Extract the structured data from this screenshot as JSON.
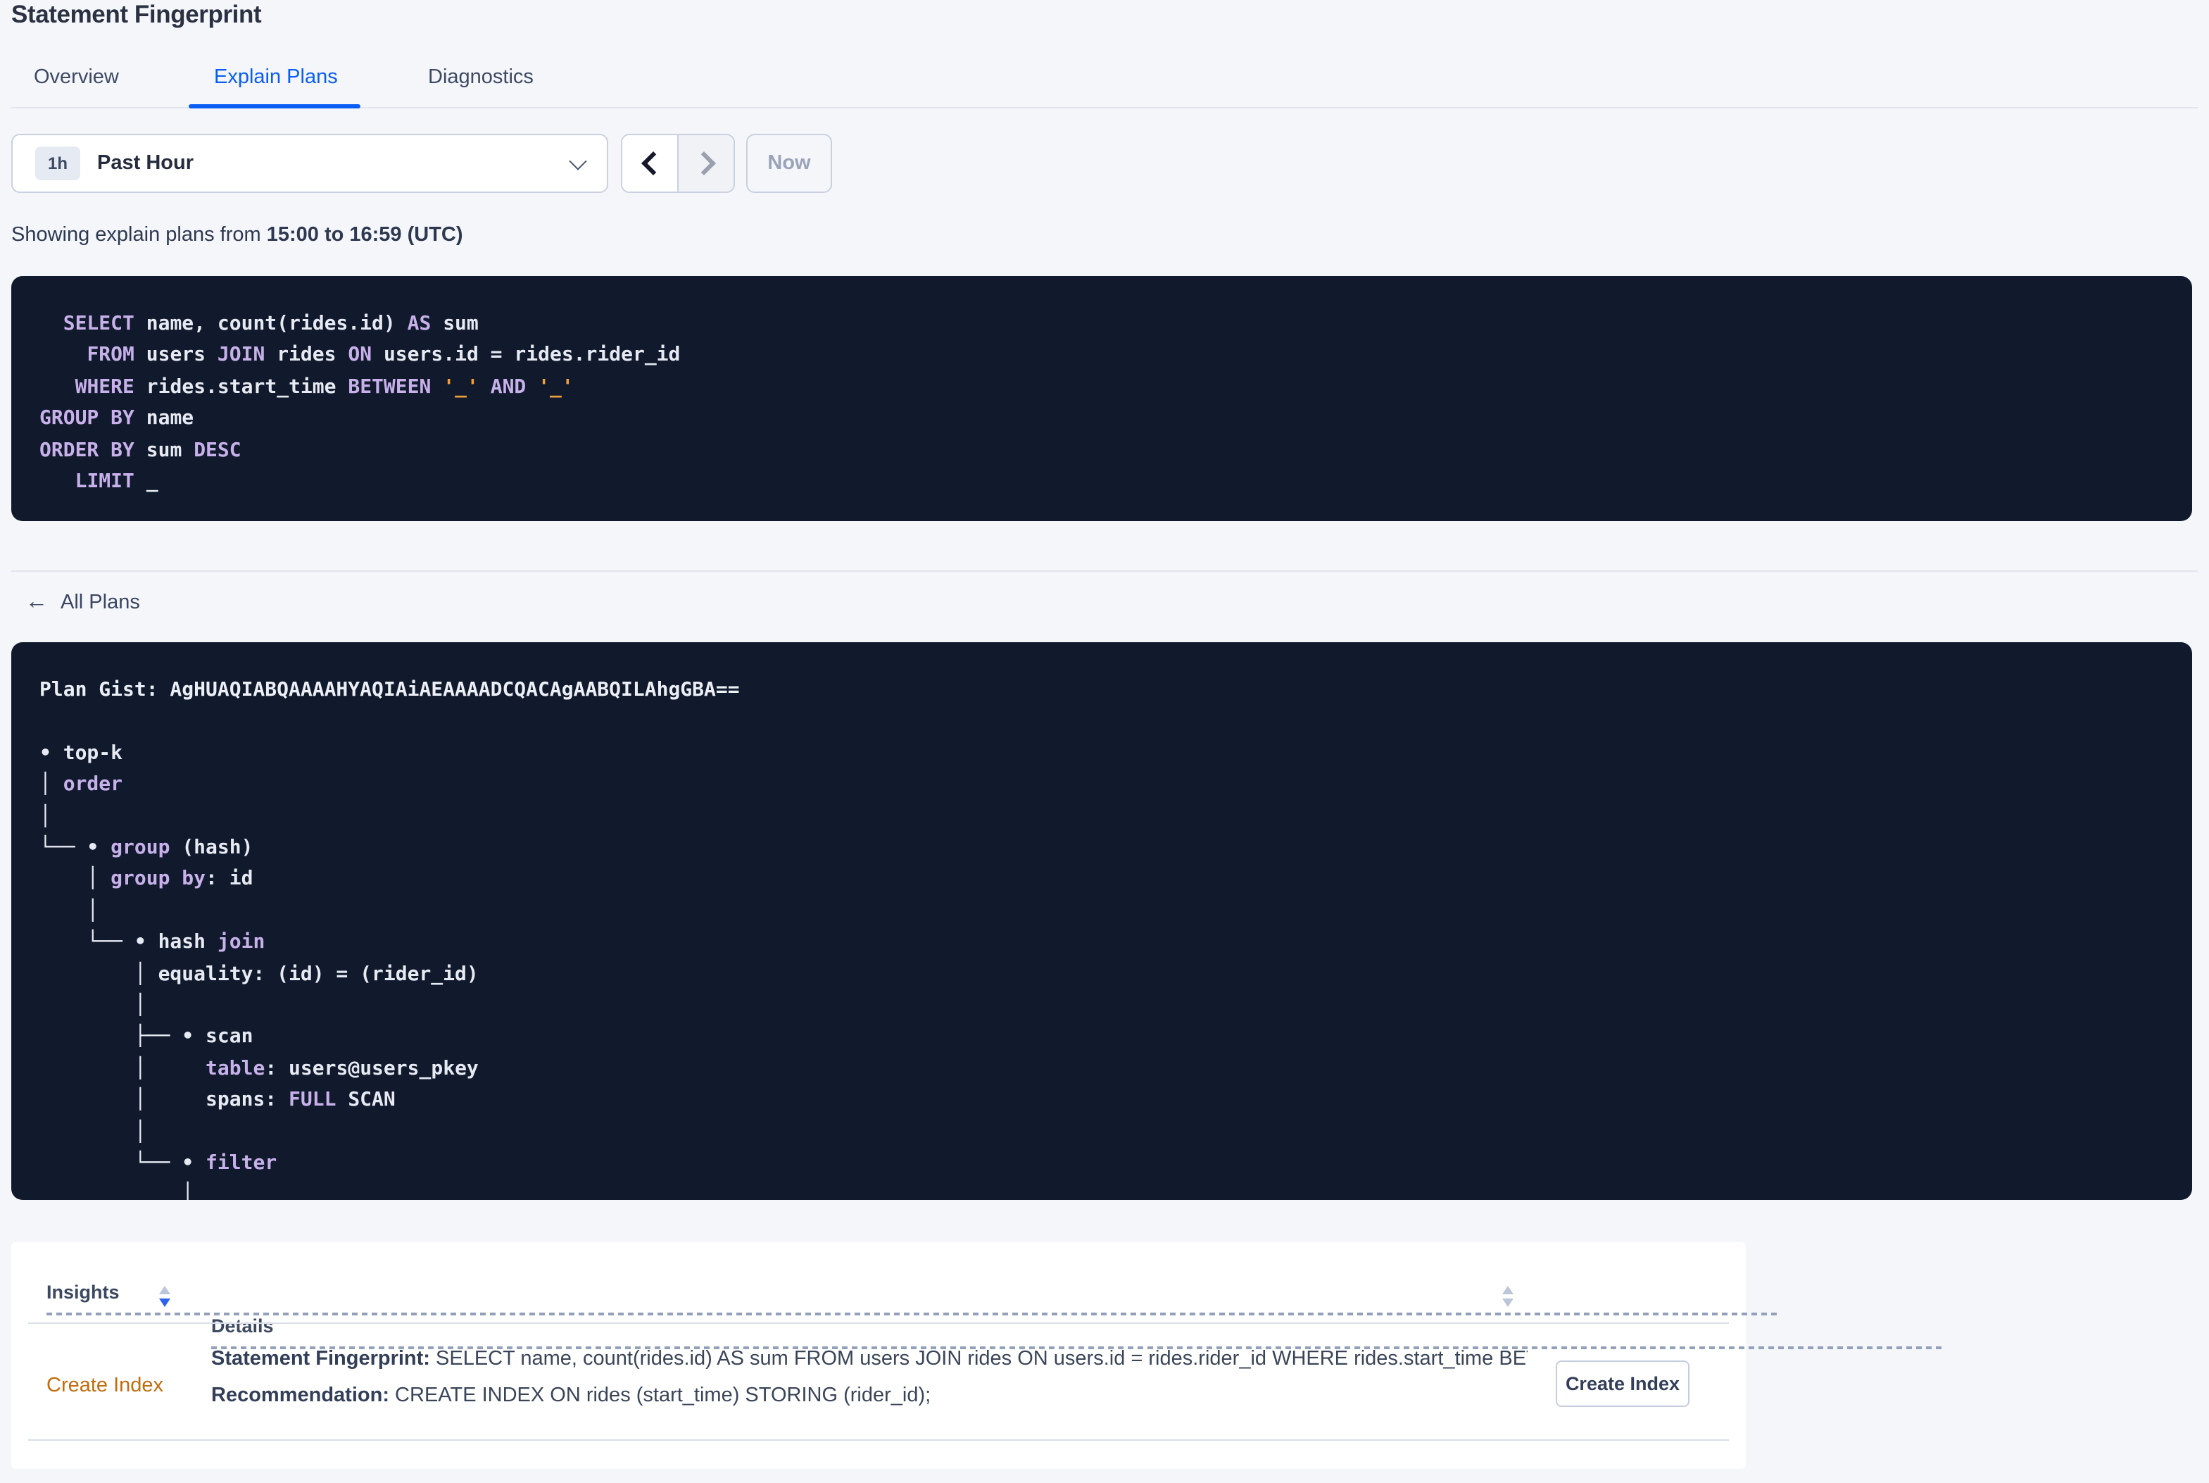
{
  "header": {
    "title": "Statement Fingerprint"
  },
  "tabs": [
    {
      "label": "Overview"
    },
    {
      "label": "Explain Plans"
    },
    {
      "label": "Diagnostics"
    }
  ],
  "toolbar": {
    "range_badge": "1h",
    "range_label": "Past Hour",
    "now_label": "Now"
  },
  "subtitle": {
    "prefix": "Showing explain plans from ",
    "bold_range": "15:00 to 16:59 (UTC)"
  },
  "sql_block": {
    "lines": [
      [
        [
          "p",
          "  "
        ],
        [
          "k",
          "SELECT"
        ],
        [
          "p",
          " name, count(rides.id) "
        ],
        [
          "k",
          "AS"
        ],
        [
          "p",
          " sum"
        ]
      ],
      [
        [
          "p",
          "    "
        ],
        [
          "k",
          "FROM"
        ],
        [
          "p",
          " users "
        ],
        [
          "k",
          "JOIN"
        ],
        [
          "p",
          " rides "
        ],
        [
          "k",
          "ON"
        ],
        [
          "p",
          " users.id = rides.rider_id"
        ]
      ],
      [
        [
          "p",
          "   "
        ],
        [
          "k",
          "WHERE"
        ],
        [
          "p",
          " rides.start_time "
        ],
        [
          "k",
          "BETWEEN"
        ],
        [
          "p",
          " "
        ],
        [
          "o",
          "'_'"
        ],
        [
          "p",
          " "
        ],
        [
          "k",
          "AND"
        ],
        [
          "p",
          " "
        ],
        [
          "o",
          "'_'"
        ]
      ],
      [
        [
          "k",
          "GROUP BY"
        ],
        [
          "p",
          " name"
        ]
      ],
      [
        [
          "k",
          "ORDER BY"
        ],
        [
          "p",
          " sum "
        ],
        [
          "k",
          "DESC"
        ]
      ],
      [
        [
          "p",
          "   "
        ],
        [
          "k",
          "LIMIT"
        ],
        [
          "p",
          " _"
        ]
      ]
    ]
  },
  "nav": {
    "back_arrow": "←",
    "all_plans_label": "All Plans"
  },
  "gist_block": {
    "lines": [
      [
        [
          "b",
          "Plan Gist: AgHUAQIABQAAAAHYAQIAiAEAAAADCQACAgAABQILAhgGBA=="
        ]
      ],
      [],
      [
        [
          "p",
          "• top-k"
        ]
      ],
      [
        [
          "p",
          "│ "
        ],
        [
          "k",
          "order"
        ]
      ],
      [
        [
          "p",
          "│"
        ]
      ],
      [
        [
          "p",
          "└── • "
        ],
        [
          "k",
          "group"
        ],
        [
          "p",
          " (hash)"
        ]
      ],
      [
        [
          "p",
          "    │ "
        ],
        [
          "k",
          "group by"
        ],
        [
          "p",
          ": id"
        ]
      ],
      [
        [
          "p",
          "    │"
        ]
      ],
      [
        [
          "p",
          "    └── • hash "
        ],
        [
          "k",
          "join"
        ]
      ],
      [
        [
          "p",
          "        │ equality: (id) = (rider_id)"
        ]
      ],
      [
        [
          "p",
          "        │"
        ]
      ],
      [
        [
          "p",
          "        ├── • scan"
        ]
      ],
      [
        [
          "p",
          "        │     "
        ],
        [
          "k",
          "table"
        ],
        [
          "p",
          ": users@users_pkey"
        ]
      ],
      [
        [
          "p",
          "        │     spans: "
        ],
        [
          "k",
          "FULL"
        ],
        [
          "p",
          " SCAN"
        ]
      ],
      [
        [
          "p",
          "        │"
        ]
      ],
      [
        [
          "p",
          "        └── • "
        ],
        [
          "k",
          "filter"
        ]
      ],
      [
        [
          "p",
          "            │"
        ]
      ]
    ]
  },
  "insights": {
    "columns": [
      {
        "label": "Insights"
      },
      {
        "label": "Details"
      }
    ],
    "row": {
      "insight_link": "Create Index",
      "fingerprint_label": "Statement Fingerprint:",
      "fingerprint_value": " SELECT name, count(rides.id) AS sum FROM users JOIN rides ON users.id = rides.rider_id WHERE rides.start_time BETWEEN '_…",
      "recommendation_label": "Recommendation:",
      "recommendation_value": " CREATE INDEX ON rides (start_time) STORING (rider_id);",
      "action_label": "Create Index"
    }
  },
  "colors": {
    "accent_blue": "#0a5ef5",
    "code_background": "#111a2d",
    "code_keyword": "#c8b1ea",
    "code_plain": "#e7eaf2",
    "code_placeholder_orange": "#f0a03c",
    "insight_link_orange": "#c16c0d",
    "page_background": "#f4f6fa"
  }
}
